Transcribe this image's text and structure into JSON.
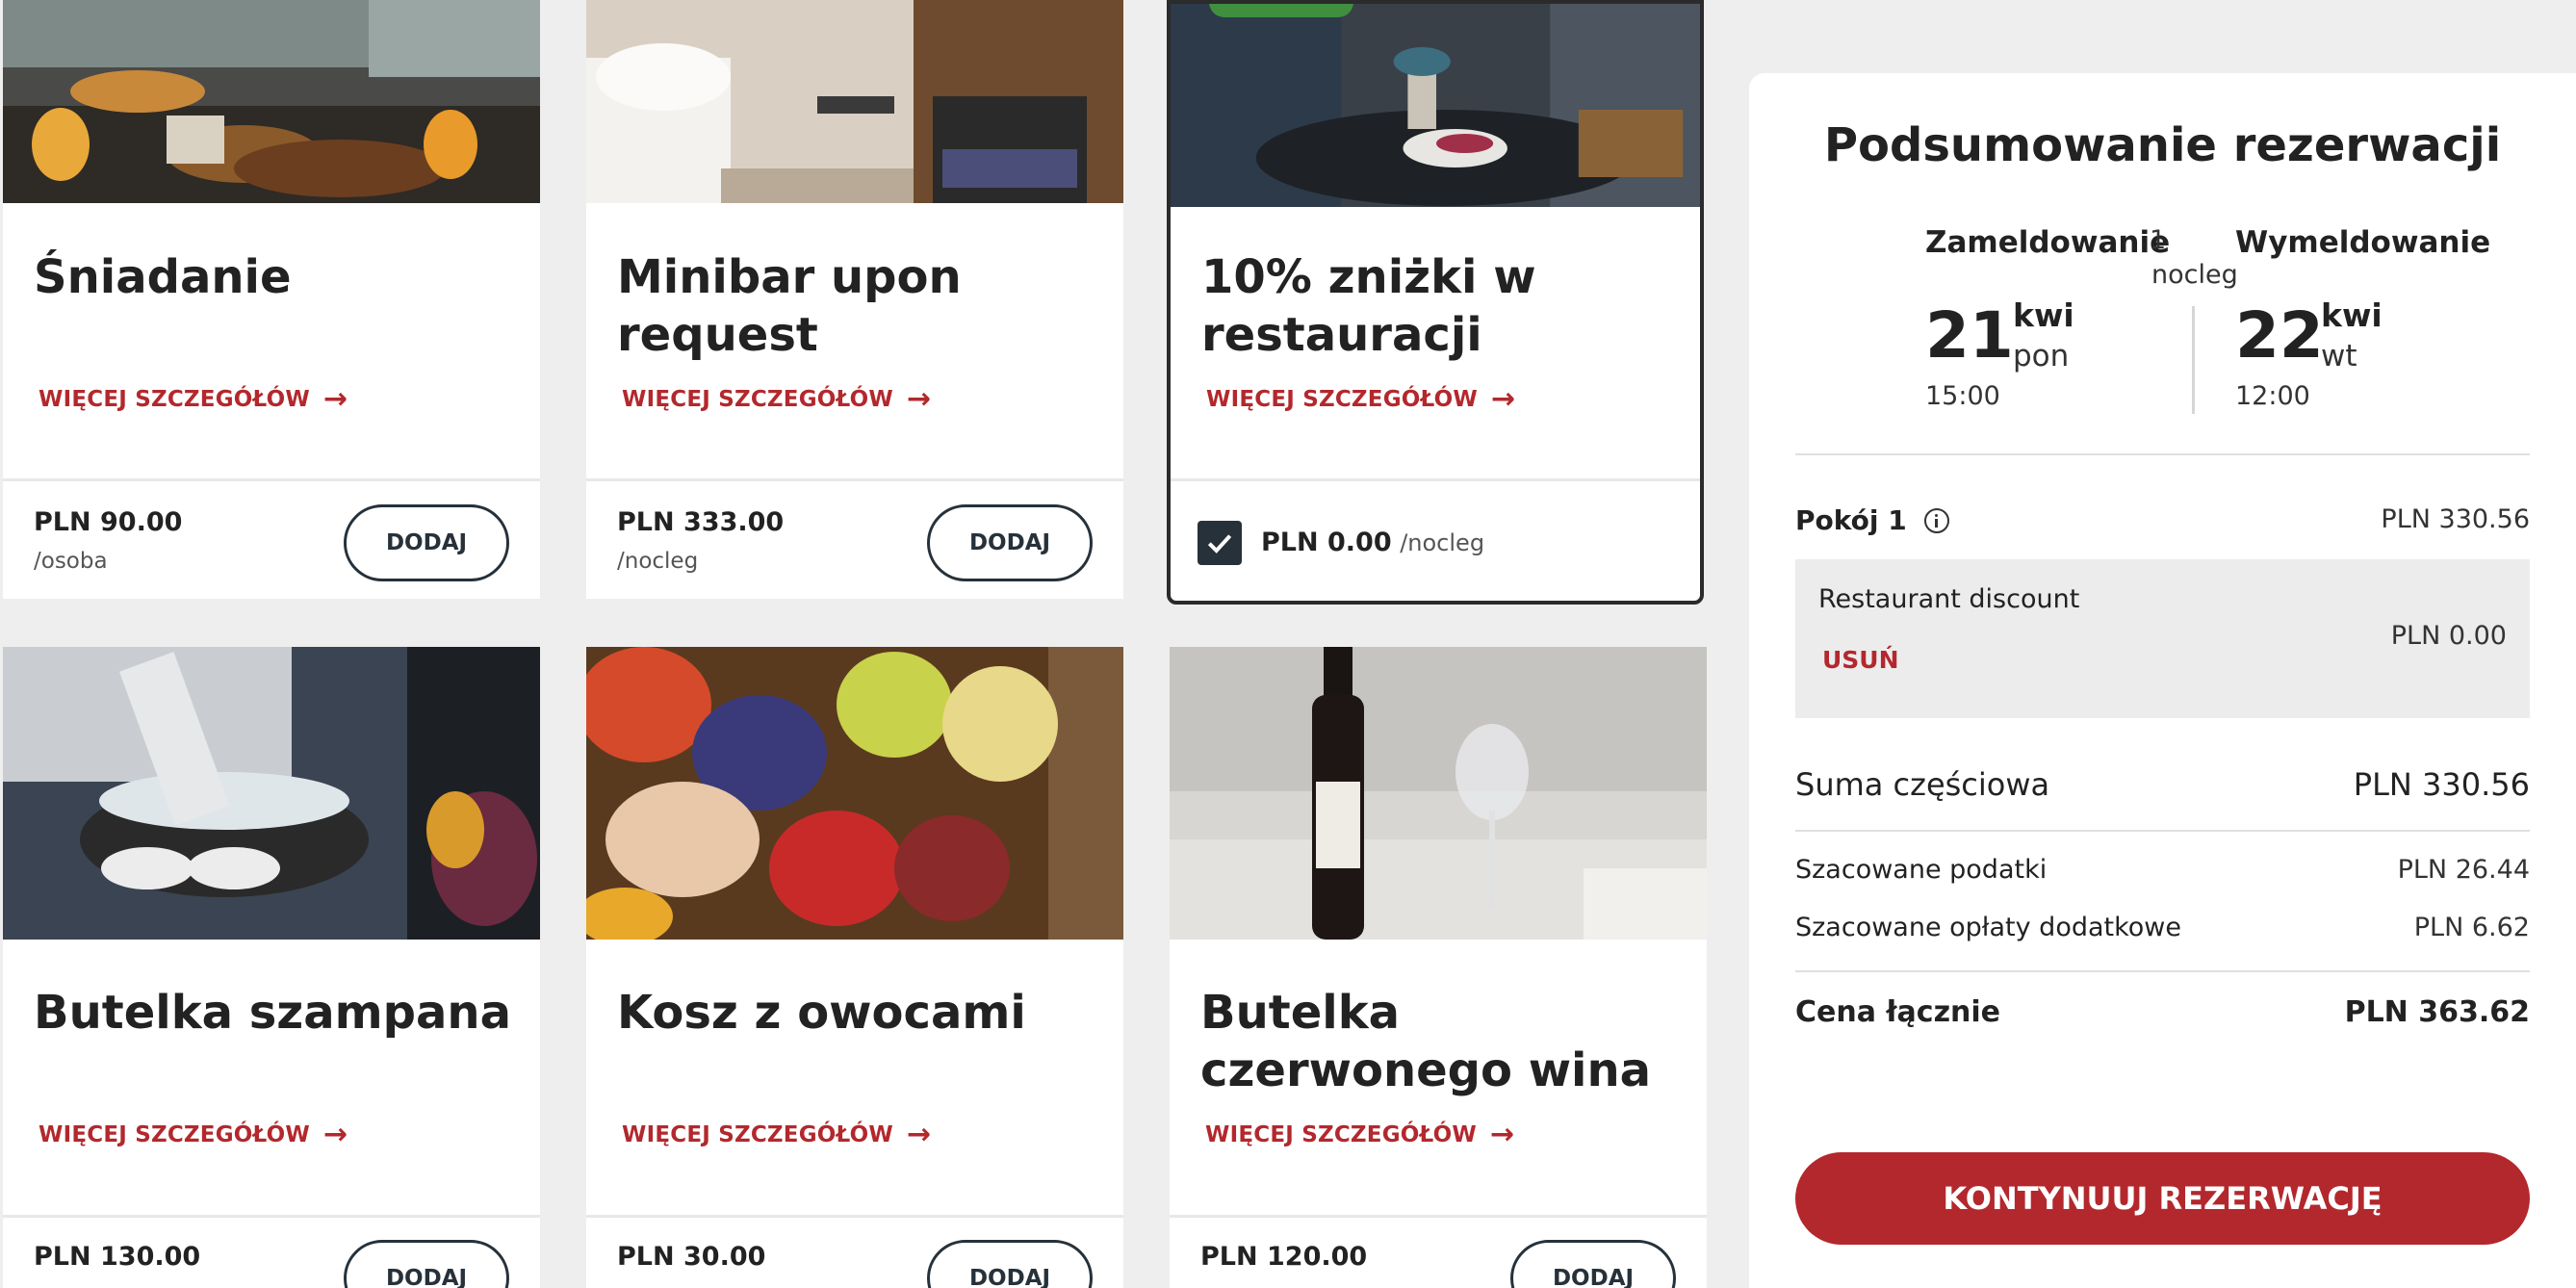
{
  "products": [
    {
      "title": "Śniadanie",
      "more": "WIĘCEJ SZCZEGÓŁÓW",
      "price": "PLN 90.00",
      "unit": "/osoba",
      "action": "DODAJ"
    },
    {
      "title": "Minibar upon request",
      "more": "WIĘCEJ SZCZEGÓŁÓW",
      "price": "PLN 333.00",
      "unit": "/nocleg",
      "action": "DODAJ"
    },
    {
      "title": "10% zniżki w restauracji",
      "more": "WIĘCEJ SZCZEGÓŁÓW",
      "price": "PLN 0.00",
      "unit": "/nocleg",
      "selected": true
    },
    {
      "title": "Butelka szampana",
      "more": "WIĘCEJ SZCZEGÓŁÓW",
      "price": "PLN 130.00",
      "action": "DODAJ"
    },
    {
      "title": "Kosz z owocami",
      "more": "WIĘCEJ SZCZEGÓŁÓW",
      "price": "PLN 30.00",
      "action": "DODAJ"
    },
    {
      "title": "Butelka czerwonego wina",
      "more": "WIĘCEJ SZCZEGÓŁÓW",
      "price": "PLN 120.00",
      "action": "DODAJ"
    }
  ],
  "icons": {
    "more": "arrow-right-icon",
    "checkbox": "checkmark-icon",
    "room_info": "info-icon"
  },
  "colors": {
    "accent": "#b3282d",
    "dark": "#26313a",
    "badge": "#3f8f3f"
  },
  "summary": {
    "title": "Podsumowanie rezerwacji",
    "checkin": {
      "label": "Zameldowanie",
      "day": "21",
      "month": "kwi",
      "weekday": "pon",
      "time": "15:00"
    },
    "nights": {
      "count": "1",
      "label": "nocleg"
    },
    "checkout": {
      "label": "Wymeldowanie",
      "day": "22",
      "month": "kwi",
      "weekday": "wt",
      "time": "12:00"
    },
    "room": {
      "label": "Pokój 1",
      "price": "PLN 330.56"
    },
    "discount": {
      "name": "Restaurant discount",
      "remove": "USUŃ",
      "price": "PLN 0.00"
    },
    "subtotal": {
      "label": "Suma częściowa",
      "value": "PLN 330.56"
    },
    "taxes": {
      "label": "Szacowane podatki",
      "value": "PLN 26.44"
    },
    "fees": {
      "label": "Szacowane opłaty dodatkowe",
      "value": "PLN 6.62"
    },
    "total": {
      "label": "Cena łącznie",
      "value": "PLN 363.62"
    },
    "continue": "KONTYNUUJ REZERWACJĘ"
  }
}
